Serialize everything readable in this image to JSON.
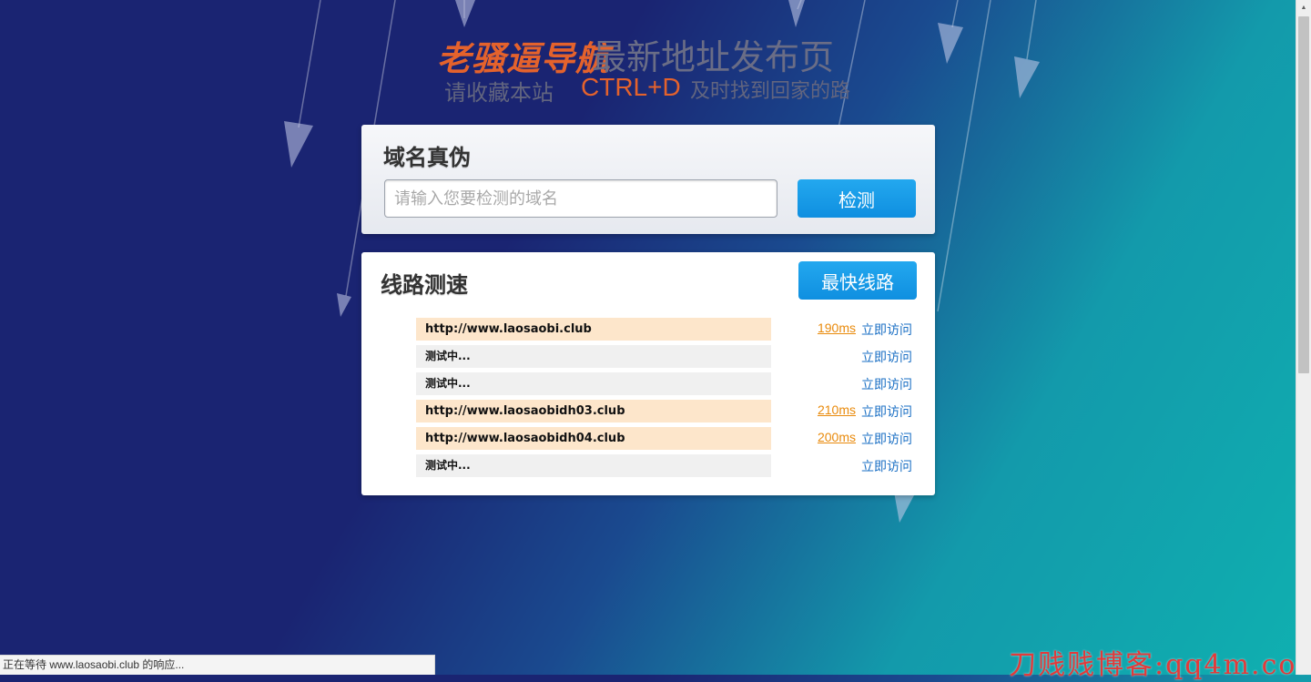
{
  "colors": {
    "brand_orange": "#e4622c",
    "button_blue": "#1a9be8",
    "ok_row_bg": "#fde6cb",
    "testing_row_bg": "#f0f0f0",
    "latency": "#e98a0b",
    "visit_link": "#1a6fc4",
    "watermark": "#e23a3a"
  },
  "header": {
    "brand": "老骚逼导航",
    "headline": "最新地址发布页",
    "bookmark_prefix": "请收藏本站",
    "shortcut": "CTRL+D",
    "bookmark_suffix": "及时找到回家的路"
  },
  "domain_check": {
    "title": "域名真伪",
    "input_placeholder": "请输入您要检测的域名",
    "input_value": "",
    "button_label": "检测"
  },
  "speed_test": {
    "title": "线路测速",
    "fastest_button_label": "最快线路",
    "lines": [
      {
        "status": "ok",
        "url": "http://www.laosaobi.club",
        "latency": "190ms",
        "visit_label": "立即访问"
      },
      {
        "status": "testing",
        "url": "测试中...",
        "latency": "",
        "visit_label": "立即访问"
      },
      {
        "status": "testing",
        "url": "测试中...",
        "latency": "",
        "visit_label": "立即访问"
      },
      {
        "status": "ok",
        "url": "http://www.laosaobidh03.club",
        "latency": "210ms",
        "visit_label": "立即访问"
      },
      {
        "status": "ok",
        "url": "http://www.laosaobidh04.club",
        "latency": "200ms",
        "visit_label": "立即访问"
      },
      {
        "status": "testing",
        "url": "测试中...",
        "latency": "",
        "visit_label": "立即访问"
      }
    ]
  },
  "status_bar": {
    "text": "正在等待 www.laosaobi.club 的响应..."
  },
  "watermark": {
    "text": "刀贱贱博客:qq4m.com"
  }
}
